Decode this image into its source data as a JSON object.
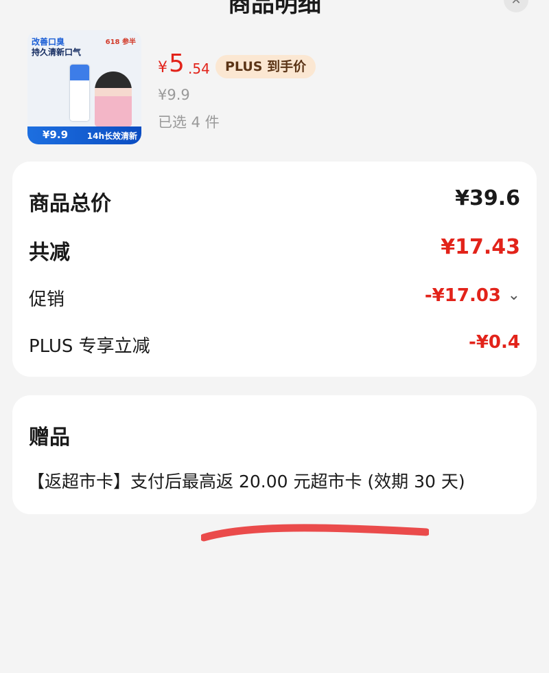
{
  "header": {
    "title": "商品明细",
    "close_icon": "close-icon"
  },
  "product": {
    "thumbnail": {
      "headline1": "改善口臭",
      "headline2": "持久清新口气",
      "brand": "618 参半",
      "badge_price": "¥9.9",
      "slogan": "14h长效清新"
    },
    "price_symbol": "¥",
    "price_integer": "5",
    "price_decimal": ".54",
    "plus_badge": "PLUS 到手价",
    "original_price": "¥9.9",
    "selected_count": "已选 4 件"
  },
  "summary": {
    "total_label": "商品总价",
    "total_value": "¥39.6",
    "reduce_label": "共减",
    "reduce_value": "¥17.43",
    "promo_label": "促销",
    "promo_value": "-¥17.03",
    "plus_label": "PLUS 专享立减",
    "plus_value": "-¥0.4"
  },
  "gift": {
    "title": "赠品",
    "text": "【返超市卡】支付后最高返 20.00 元超市卡 (效期 30 天)"
  },
  "colors": {
    "accent_red": "#e2231a",
    "plus_badge_bg": "#fbe7d2",
    "background": "#f4f4f4",
    "annotation_stroke": "#ea4b4b"
  }
}
